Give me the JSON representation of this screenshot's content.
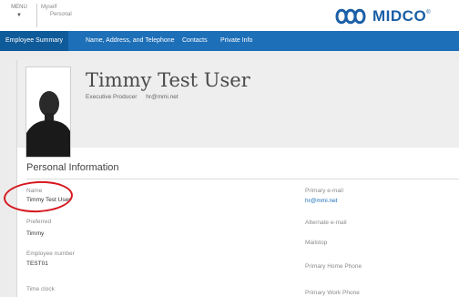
{
  "topbar": {
    "menu_label": "MENU",
    "menu_arrow": "▼",
    "myself_label": "Myself",
    "myself_sub": "Personal",
    "logo_text": "MIDCO",
    "logo_mark": "®"
  },
  "nav": {
    "tabs": [
      {
        "label": "Employee Summary",
        "active": true
      },
      {
        "label": "Name, Address, and Telephone",
        "active": false
      },
      {
        "label": "Contacts",
        "active": false
      },
      {
        "label": "Private Info",
        "active": false
      }
    ]
  },
  "profile": {
    "name": "Timmy Test User",
    "title": "Executive Producer",
    "email": "hr@mmi.net"
  },
  "section": {
    "title": "Personal Information"
  },
  "left_fields": [
    {
      "label": "Name",
      "value": "Timmy Test User"
    },
    {
      "label": "Preferred",
      "value": "Timmy"
    },
    {
      "label": "Employee number",
      "value": "TEST01"
    },
    {
      "label": "Time clock",
      "value": ""
    }
  ],
  "right_fields": [
    {
      "label": "Primary e-mail",
      "value": "hr@mmi.net"
    },
    {
      "label": "Alternate e-mail",
      "value": ""
    },
    {
      "label": "Mailstop",
      "value": ""
    },
    {
      "label": "Primary Home Phone",
      "value": ""
    },
    {
      "label": "Primary Work Phone",
      "value": ""
    }
  ],
  "colors": {
    "nav_bg": "#1d6fb8",
    "nav_active": "#0f5a99",
    "brand": "#1b5fa6",
    "annotation": "#d6181f"
  }
}
